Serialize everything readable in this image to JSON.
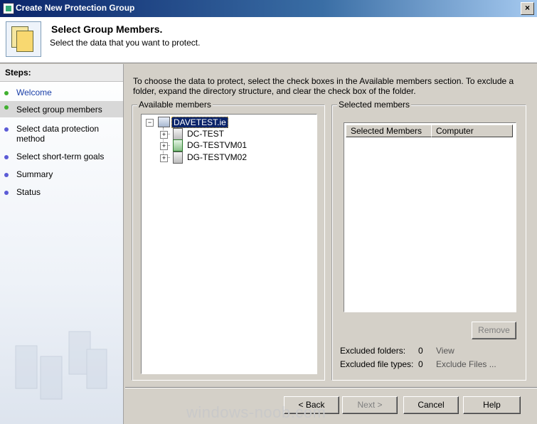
{
  "window": {
    "title": "Create New Protection Group",
    "close_label": "×"
  },
  "header": {
    "title": "Select Group Members.",
    "subtitle": "Select the data that you want to protect."
  },
  "sidebar": {
    "heading": "Steps:",
    "items": [
      {
        "label": "Welcome",
        "state": "done"
      },
      {
        "label": "Select group members",
        "state": "current"
      },
      {
        "label": "Select data protection method",
        "state": "pending"
      },
      {
        "label": "Select short-term goals",
        "state": "pending"
      },
      {
        "label": "Summary",
        "state": "pending"
      },
      {
        "label": "Status",
        "state": "pending"
      }
    ]
  },
  "main": {
    "instructions": "To choose the data to protect, select the check boxes in the Available members section. To exclude a folder, expand the directory structure, and clear the check box of the folder.",
    "available": {
      "label": "Available members",
      "tree": [
        {
          "label": "DAVETEST.ie",
          "expander": "−",
          "icon": "domain-icon",
          "selected": true
        },
        {
          "label": "DC-TEST",
          "expander": "+",
          "icon": "server-icon"
        },
        {
          "label": "DG-TESTVM01",
          "expander": "+",
          "icon": "server-refresh-icon"
        },
        {
          "label": "DG-TESTVM02",
          "expander": "+",
          "icon": "server-icon"
        }
      ]
    },
    "selected": {
      "label": "Selected members",
      "columns": [
        "Selected Members",
        "Computer"
      ],
      "remove_label": "Remove",
      "excluded_folders_label": "Excluded folders:",
      "excluded_folders_count": "0",
      "view_label": "View",
      "excluded_types_label": "Excluded file types:",
      "excluded_types_count": "0",
      "exclude_files_label": "Exclude Files ..."
    }
  },
  "footer": {
    "back_label": "< Back",
    "next_label": "Next >",
    "cancel_label": "Cancel",
    "help_label": "Help"
  },
  "watermark": "windows-noob.com"
}
